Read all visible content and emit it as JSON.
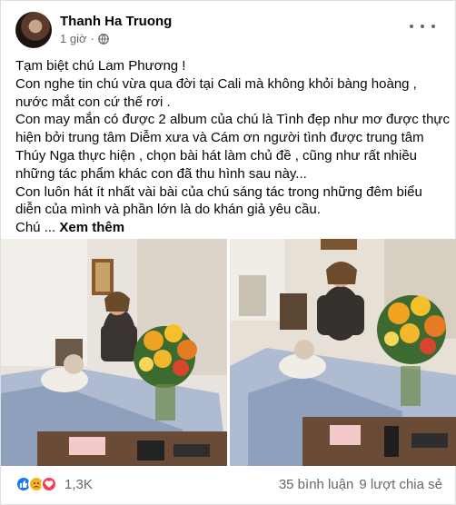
{
  "post": {
    "author": "Thanh Ha Truong",
    "time": "1 giờ",
    "dot": "·",
    "text_lines": [
      "Tạm biệt chú Lam Phương !",
      "Con nghe tin chú vừa qua đời tại Cali mà không khỏi bàng hoàng ,",
      "nước mắt con cứ thế rơi .",
      "Con may mắn có được 2 album của chú là Tình đẹp như mơ được thực",
      "hiện bởi trung tâm Diễm xưa và Cám ơn người tình được trung tâm",
      "Thúy Nga thực hiện , chọn bài hát làm chủ đề , cũng như rất nhiều",
      "những tác phẩm khác con đã thu hình sau này...",
      "Con luôn hát ít nhất vài bài của chú sáng tác trong những đêm biểu",
      "diễn của mình và phần lớn là do khán giả yêu cầu."
    ],
    "last_line_prefix": "Chú ...",
    "see_more": "Xem thêm"
  },
  "reactions": {
    "count": "1,3K",
    "types": [
      "like-icon",
      "sad-icon",
      "love-icon"
    ],
    "colors": {
      "like": "#1877f2",
      "sad": "#f7b125",
      "love": "#f33e58"
    }
  },
  "stats": {
    "comments": "35 bình luận",
    "shares": "9 lượt chia sẻ"
  }
}
